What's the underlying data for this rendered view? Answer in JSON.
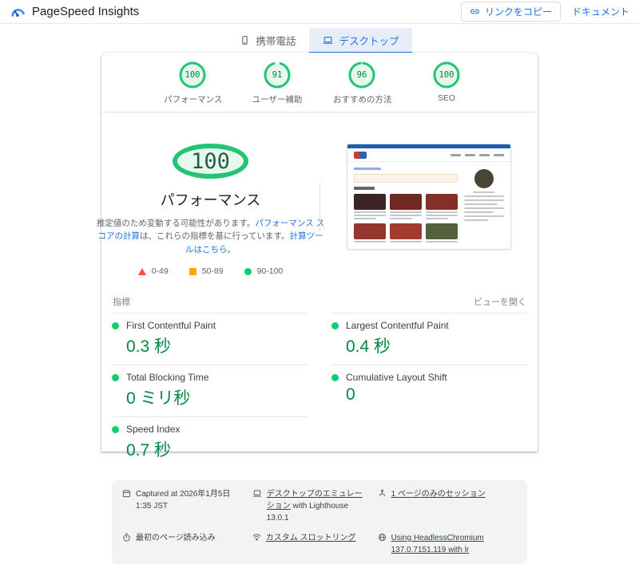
{
  "header": {
    "title": "PageSpeed Insights",
    "copy_link_label": "リンクをコピー",
    "docs_label": "ドキュメント"
  },
  "tabs": {
    "mobile": "携帯電話",
    "desktop": "デスクトップ"
  },
  "scores": [
    {
      "label": "パフォーマンス",
      "value": "100"
    },
    {
      "label": "ユーザー補助",
      "value": "91"
    },
    {
      "label": "おすすめの方法",
      "value": "96"
    },
    {
      "label": "SEO",
      "value": "100"
    }
  ],
  "gauge": {
    "value": "100",
    "title": "パフォーマンス",
    "desc_part1": "推定値のため変動する可能性があります。",
    "desc_link1": "パフォーマンス スコアの計算",
    "desc_part2": "は、これらの指標を基に行っています。",
    "desc_link2": "計算ツールはこちら。"
  },
  "legend": [
    {
      "shape": "triangle",
      "color": "#ff4e42",
      "range": "0-49"
    },
    {
      "shape": "square",
      "color": "#ffa400",
      "range": "50-89"
    },
    {
      "shape": "circle",
      "color": "#0cce6b",
      "range": "90-100"
    }
  ],
  "metrics_section": {
    "heading": "指標",
    "expand_label": "ビューを開く",
    "left": [
      {
        "name": "First Contentful Paint",
        "value": "0.3 秒"
      },
      {
        "name": "Total Blocking Time",
        "value": "0 ミリ秒"
      },
      {
        "name": "Speed Index",
        "value": "0.7 秒"
      }
    ],
    "right": [
      {
        "name": "Largest Contentful Paint",
        "value": "0.4 秒"
      },
      {
        "name": "Cumulative Layout Shift",
        "value": "0"
      }
    ]
  },
  "runinfo": {
    "captured": "Captured at 2026年1月5日 1:35 JST",
    "emulation_link": "デスクトップのエミュレーション",
    "emulation_rest": " with Lighthouse 13.0.1",
    "session": "1 ページのみのセッション",
    "first_load": "最初のページ読み込み",
    "throttling": "カスタム スロットリング",
    "chromium": "Using HeadlessChromium 137.0.7151.119 with lr"
  },
  "colors": {
    "accent_blue": "#1a73e8",
    "pass_green": "#0cce6b",
    "pass_text": "#018642",
    "average_orange": "#ffa400",
    "fail_red": "#ff4e42"
  }
}
